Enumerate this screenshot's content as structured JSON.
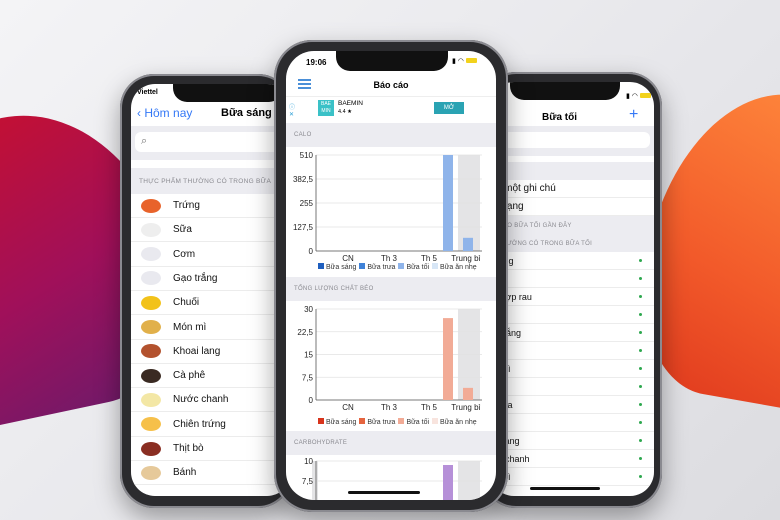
{
  "colors": {
    "accent": "#3478f6",
    "calo_bar": "#8fb4ea",
    "fat_bar": "#f2ab96",
    "carb_bar": "#b690d8",
    "avg_bg": "#e4e4e6",
    "mo_button": "#2aa3b3",
    "dot": "#2ea84f"
  },
  "left_phone": {
    "carrier": "Viettel",
    "back_label": "Hôm nay",
    "title": "Bữa sáng",
    "search_icon": "search-icon",
    "section": "THỰC PHẨM THƯỜNG CÓ TRONG BỮA",
    "items": [
      {
        "label": "Trứng",
        "icon": "egg-icon",
        "color": "#e8632b"
      },
      {
        "label": "Sữa",
        "icon": "milk-icon",
        "color": "#eeeeee"
      },
      {
        "label": "Cơm",
        "icon": "rice-bowl-icon",
        "color": "#e9e9ef"
      },
      {
        "label": "Gạo trắng",
        "icon": "rice-bowl-icon",
        "color": "#e9e9ef"
      },
      {
        "label": "Chuối",
        "icon": "banana-icon",
        "color": "#f2c21a"
      },
      {
        "label": "Món mì",
        "icon": "noodle-icon",
        "color": "#e1b04a"
      },
      {
        "label": "Khoai lang",
        "icon": "sweet-potato-icon",
        "color": "#b3522e"
      },
      {
        "label": "Cà phê",
        "icon": "coffee-icon",
        "color": "#3a2a22"
      },
      {
        "label": "Nước chanh",
        "icon": "lemonade-icon",
        "color": "#f3e7a5"
      },
      {
        "label": "Chiên trứng",
        "icon": "fried-egg-icon",
        "color": "#f6c04a"
      },
      {
        "label": "Thịt bò",
        "icon": "beef-icon",
        "color": "#8a2e22"
      },
      {
        "label": "Bánh",
        "icon": "bread-icon",
        "color": "#e6c99a"
      }
    ]
  },
  "center_phone": {
    "time": "19:06",
    "title": "Báo cáo",
    "menu_icon": "hamburger-menu-icon",
    "ad": {
      "logo": "BAE MIN",
      "name": "BAEMIN",
      "rating": "4.4 ★",
      "button": "MỞ"
    },
    "charts": [
      {
        "section": "CALO",
        "type": "bar",
        "categories": [
          "CN",
          "Th 3",
          "Th 5",
          "Trung bì"
        ],
        "y_ticks": [
          "0",
          "127,5",
          "255",
          "382,5",
          "510"
        ],
        "ylim": [
          0,
          510
        ],
        "values": {
          "Th 5": 510,
          "Trung bình": 70
        },
        "legend": [
          "Bữa sáng",
          "Bữa trưa",
          "Bữa tối",
          "Bữa ăn nhẹ"
        ],
        "legend_colors": [
          "#1f5fbf",
          "#3f82d8",
          "#8fb4ea",
          "#d7e6f6"
        ],
        "bar_color": "#8fb4ea"
      },
      {
        "section": "TỔNG LƯỢNG CHẤT BÉO",
        "type": "bar",
        "categories": [
          "CN",
          "Th 3",
          "Th 5",
          "Trung bì"
        ],
        "y_ticks": [
          "0",
          "7,5",
          "15",
          "22,5",
          "30"
        ],
        "ylim": [
          0,
          30
        ],
        "values": {
          "Th 5": 27,
          "Trung bình": 4
        },
        "legend": [
          "Bữa sáng",
          "Bữa trưa",
          "Bữa tối",
          "Bữa ăn nhẹ"
        ],
        "legend_colors": [
          "#d8341c",
          "#e5643f",
          "#f2ab96",
          "#f8e4de"
        ],
        "bar_color": "#f2ab96"
      },
      {
        "section": "CARBOHYDRATE",
        "type": "bar",
        "y_ticks": [
          "7,5",
          "10"
        ],
        "ylim": [
          0,
          10
        ],
        "values": {
          "Th 5": 9.5
        },
        "bar_color": "#b690d8"
      }
    ]
  },
  "right_phone": {
    "title": "Bữa tối",
    "back_fragment": "y",
    "add_icon": "+",
    "sections": {
      "options": "ỌN",
      "recent": "CHO BỮA TỐI GẦN ĐÂY",
      "common": "THƯỜNG CÓ TRONG BỮA TỐI"
    },
    "options": [
      "m một ghi chú",
      "n dạng"
    ],
    "items": [
      "trắng",
      "n",
      "a hợp rau",
      "ng",
      "n trắng",
      "gà",
      "h mì",
      "bò",
      "chua",
      "ối",
      "ai lang",
      "ốc chanh",
      "h mì"
    ]
  }
}
